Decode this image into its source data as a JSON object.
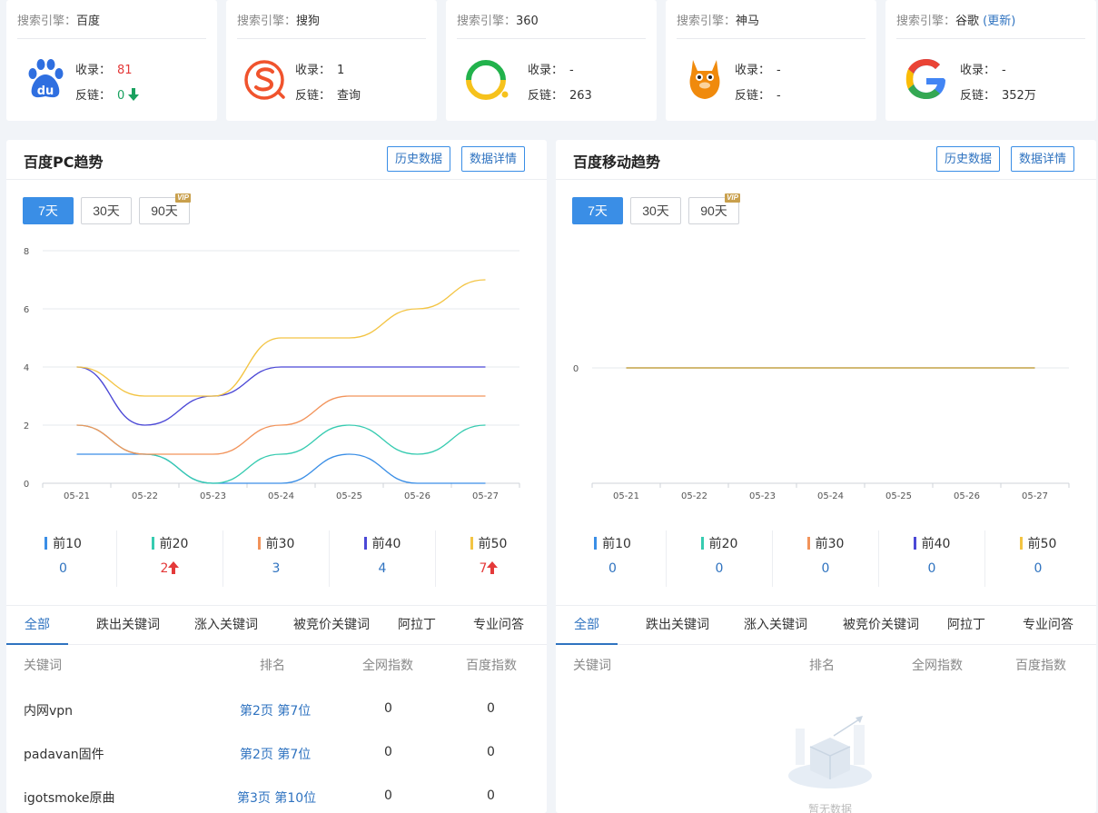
{
  "engines": [
    {
      "label": "搜索引擎：",
      "name": "百度",
      "update": "",
      "logo": "baidu-logo",
      "index_label": "收录：",
      "index_value": "81",
      "backlink_label": "反链：",
      "backlink_value": "0"
    },
    {
      "label": "搜索引擎：",
      "name": "搜狗",
      "update": "",
      "logo": "sogou-logo",
      "index_label": "收录：",
      "index_value": "1",
      "backlink_label": "反链：",
      "backlink_value": "查询"
    },
    {
      "label": "搜索引擎：",
      "name": "360",
      "update": "",
      "logo": "so360-logo",
      "index_label": "收录：",
      "index_value": "-",
      "backlink_label": "反链：",
      "backlink_value": "263"
    },
    {
      "label": "搜索引擎：",
      "name": "神马",
      "update": "",
      "logo": "shenma-logo",
      "index_label": "收录：",
      "index_value": "-",
      "backlink_label": "反链：",
      "backlink_value": "-"
    },
    {
      "label": "搜索引擎：",
      "name": "谷歌",
      "update": "(更新)",
      "logo": "google-logo",
      "index_label": "收录：",
      "index_value": "-",
      "backlink_label": "反链：",
      "backlink_value": "352万"
    }
  ],
  "colors": {
    "top10": "#3a8ee6",
    "top20": "#36cbb0",
    "top30": "#f2935a",
    "top40": "#4b48d6",
    "top50": "#f3c443",
    "accent": "#3a8ee6",
    "up": "#e43a3a",
    "down": "#19a15f"
  },
  "pc_panel": {
    "title": "百度PC趋势",
    "history_btn": "历史数据",
    "detail_btn": "数据详情",
    "ranges": [
      "7天",
      "30天",
      "90天"
    ],
    "vip": "VIP",
    "legend": [
      {
        "name": "前10",
        "value": "0",
        "trend": ""
      },
      {
        "name": "前20",
        "value": "2",
        "trend": "up"
      },
      {
        "name": "前30",
        "value": "3",
        "trend": ""
      },
      {
        "name": "前40",
        "value": "4",
        "trend": ""
      },
      {
        "name": "前50",
        "value": "7",
        "trend": "up"
      }
    ],
    "tabs": [
      "全部",
      "跌出关键词",
      "涨入关键词",
      "被竞价关键词",
      "阿拉丁",
      "专业问答"
    ],
    "columns": [
      "关键词",
      "排名",
      "全网指数",
      "百度指数"
    ],
    "rows": [
      {
        "keyword": "内网vpn",
        "rank": "第2页 第7位",
        "net_index": "0",
        "baidu_index": "0"
      },
      {
        "keyword": "padavan固件",
        "rank": "第2页 第7位",
        "net_index": "0",
        "baidu_index": "0"
      },
      {
        "keyword": "igotsmoke原曲",
        "rank": "第3页 第10位",
        "net_index": "0",
        "baidu_index": "0"
      }
    ]
  },
  "mobile_panel": {
    "title": "百度移动趋势",
    "history_btn": "历史数据",
    "detail_btn": "数据详情",
    "ranges": [
      "7天",
      "30天",
      "90天"
    ],
    "vip": "VIP",
    "legend": [
      {
        "name": "前10",
        "value": "0",
        "trend": ""
      },
      {
        "name": "前20",
        "value": "0",
        "trend": ""
      },
      {
        "name": "前30",
        "value": "0",
        "trend": ""
      },
      {
        "name": "前40",
        "value": "0",
        "trend": ""
      },
      {
        "name": "前50",
        "value": "0",
        "trend": ""
      }
    ],
    "tabs": [
      "全部",
      "跌出关键词",
      "涨入关键词",
      "被竞价关键词",
      "阿拉丁",
      "专业问答"
    ],
    "columns": [
      "关键词",
      "排名",
      "全网指数",
      "百度指数"
    ],
    "empty_text": "暂无数据"
  },
  "chart_data": [
    {
      "type": "line",
      "title": "百度PC趋势",
      "x": [
        "05-21",
        "05-22",
        "05-23",
        "05-24",
        "05-25",
        "05-26",
        "05-27"
      ],
      "ylim": [
        0,
        8
      ],
      "yticks": [
        0,
        2,
        4,
        6,
        8
      ],
      "grid": true,
      "series": [
        {
          "name": "前10",
          "values": [
            1,
            1,
            0,
            0,
            1,
            0,
            0
          ]
        },
        {
          "name": "前20",
          "values": [
            2,
            1,
            0,
            1,
            2,
            1,
            2
          ]
        },
        {
          "name": "前30",
          "values": [
            2,
            1,
            1,
            2,
            3,
            3,
            3
          ]
        },
        {
          "name": "前40",
          "values": [
            4,
            2,
            3,
            4,
            4,
            4,
            4
          ]
        },
        {
          "name": "前50",
          "values": [
            4,
            3,
            3,
            5,
            5,
            6,
            7
          ]
        }
      ]
    },
    {
      "type": "line",
      "title": "百度移动趋势",
      "x": [
        "05-21",
        "05-22",
        "05-23",
        "05-24",
        "05-25",
        "05-26",
        "05-27"
      ],
      "ylim": [
        0,
        0
      ],
      "yticks": [
        0
      ],
      "grid": true,
      "series": [
        {
          "name": "前10",
          "values": [
            0,
            0,
            0,
            0,
            0,
            0,
            0
          ]
        },
        {
          "name": "前20",
          "values": [
            0,
            0,
            0,
            0,
            0,
            0,
            0
          ]
        },
        {
          "name": "前30",
          "values": [
            0,
            0,
            0,
            0,
            0,
            0,
            0
          ]
        },
        {
          "name": "前40",
          "values": [
            0,
            0,
            0,
            0,
            0,
            0,
            0
          ]
        },
        {
          "name": "前50",
          "values": [
            0,
            0,
            0,
            0,
            0,
            0,
            0
          ]
        }
      ]
    }
  ]
}
